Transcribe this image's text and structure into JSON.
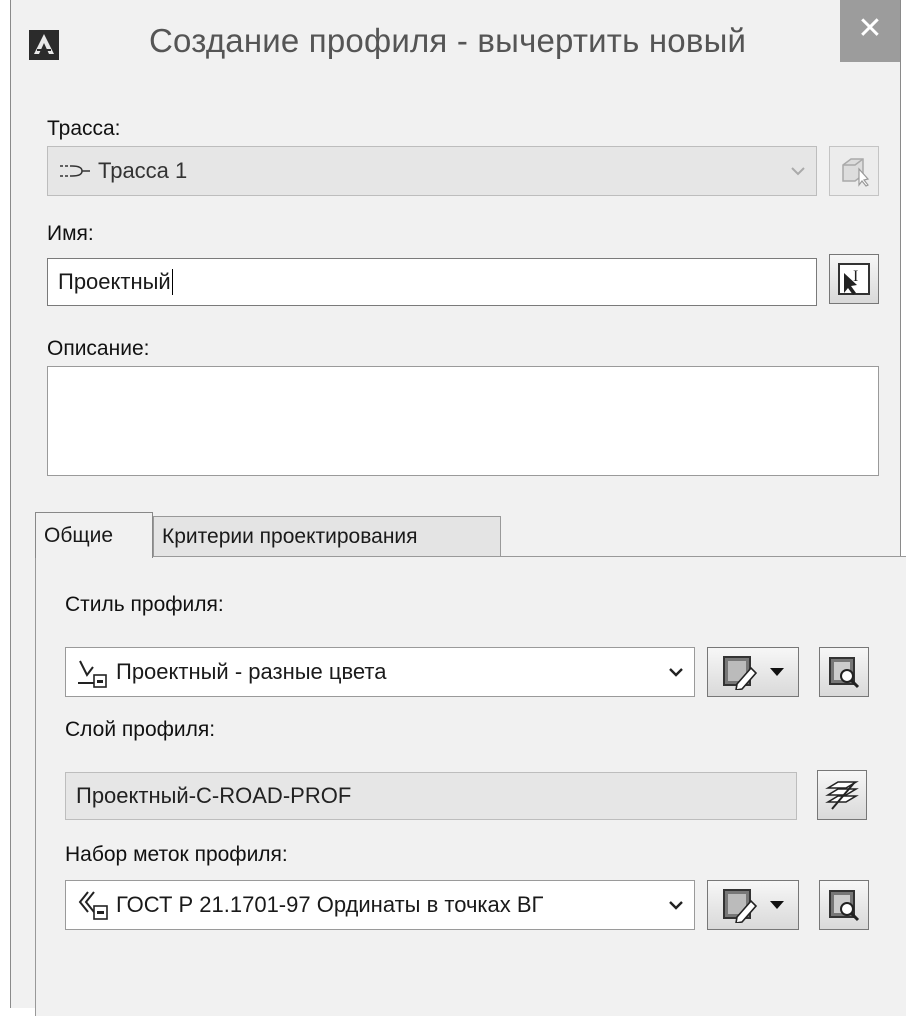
{
  "window": {
    "title": "Создание профиля - вычертить новый",
    "close_glyph": "✕"
  },
  "alignment": {
    "label": "Трасса:",
    "value": "Трасса 1",
    "icon": "alignment-icon"
  },
  "name": {
    "label": "Имя:",
    "value": "Проектный"
  },
  "description": {
    "label": "Описание:",
    "value": ""
  },
  "tabs": [
    {
      "label": "Общие",
      "active": true
    },
    {
      "label": "Критерии проектирования",
      "active": false
    }
  ],
  "general": {
    "style": {
      "label": "Стиль профиля:",
      "value": "Проектный - разные цвета",
      "icon": "profile-style-icon"
    },
    "layer": {
      "label": "Слой профиля:",
      "value": "Проектный-C-ROAD-PROF"
    },
    "label_set": {
      "label": "Набор меток профиля:",
      "value": "ГОСТ Р 21.1701-97 Ординаты в точках ВГ",
      "icon": "label-set-icon"
    }
  }
}
